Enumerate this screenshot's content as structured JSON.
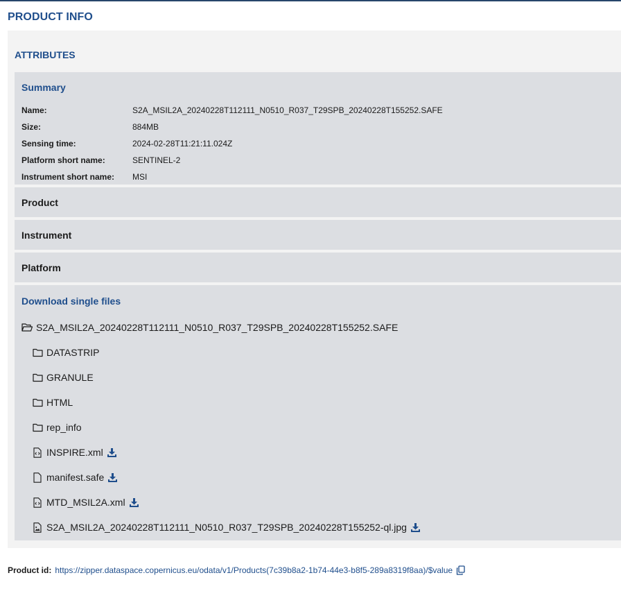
{
  "page": {
    "title": "PRODUCT INFO"
  },
  "attributes": {
    "title": "ATTRIBUTES",
    "summary": {
      "title": "Summary",
      "rows": [
        {
          "key": "Name:",
          "value": "S2A_MSIL2A_20240228T112111_N0510_R037_T29SPB_20240228T155252.SAFE"
        },
        {
          "key": "Size:",
          "value": "884MB"
        },
        {
          "key": "Sensing time:",
          "value": "2024-02-28T11:21:11.024Z"
        },
        {
          "key": "Platform short name:",
          "value": "SENTINEL-2"
        },
        {
          "key": "Instrument short name:",
          "value": "MSI"
        }
      ]
    },
    "sections": [
      {
        "title": "Product"
      },
      {
        "title": "Instrument"
      },
      {
        "title": "Platform"
      }
    ],
    "download": {
      "title": "Download single files",
      "root": {
        "name": "S2A_MSIL2A_20240228T112111_N0510_R037_T29SPB_20240228T155252.SAFE",
        "icon": "folder-open-icon"
      },
      "items": [
        {
          "name": "DATASTRIP",
          "icon": "folder-icon",
          "downloadable": false
        },
        {
          "name": "GRANULE",
          "icon": "folder-icon",
          "downloadable": false
        },
        {
          "name": "HTML",
          "icon": "folder-icon",
          "downloadable": false
        },
        {
          "name": "rep_info",
          "icon": "folder-icon",
          "downloadable": false
        },
        {
          "name": "INSPIRE.xml",
          "icon": "file-code-icon",
          "downloadable": true
        },
        {
          "name": "manifest.safe",
          "icon": "file-icon",
          "downloadable": true
        },
        {
          "name": "MTD_MSIL2A.xml",
          "icon": "file-code-icon",
          "downloadable": true
        },
        {
          "name": "S2A_MSIL2A_20240228T112111_N0510_R037_T29SPB_20240228T155252-ql.jpg",
          "icon": "file-image-icon",
          "downloadable": true
        }
      ]
    }
  },
  "product_id": {
    "label": "Product id:",
    "url": "https://zipper.dataspace.copernicus.eu/odata/v1/Products(7c39b8a2-1b74-44e3-b8f5-289a8319f8aa)/$value"
  },
  "colors": {
    "accent": "#1f4e8c",
    "panel": "#dcdee2",
    "outer": "#f3f3f3"
  }
}
